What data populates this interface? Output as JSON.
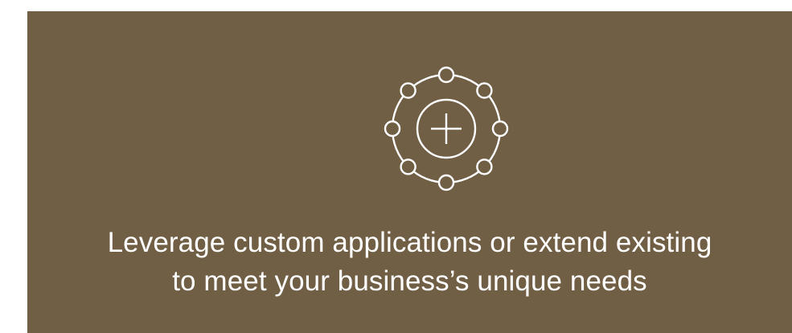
{
  "colors": {
    "panel_background": "#715f45",
    "foreground": "#ffffff"
  },
  "icon": {
    "name": "add-integration-icon"
  },
  "headline": {
    "line1": "Leverage custom applications or extend existing",
    "line2": "to meet your business’s unique needs"
  }
}
